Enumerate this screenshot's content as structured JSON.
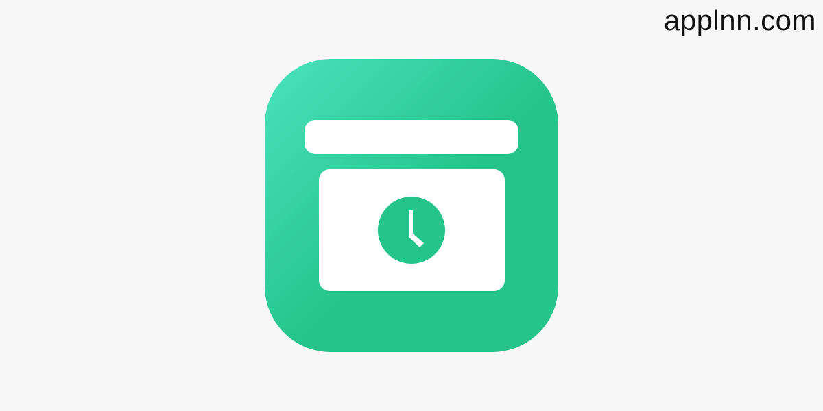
{
  "watermark": {
    "text": "applnn.com"
  },
  "app_icon": {
    "icon": "archive-box-clock-icon",
    "colors": {
      "gradient_light": "#4ae2bd",
      "gradient_dark": "#24c48b",
      "foreground": "#ffffff",
      "background": "#f7f7f7"
    }
  }
}
